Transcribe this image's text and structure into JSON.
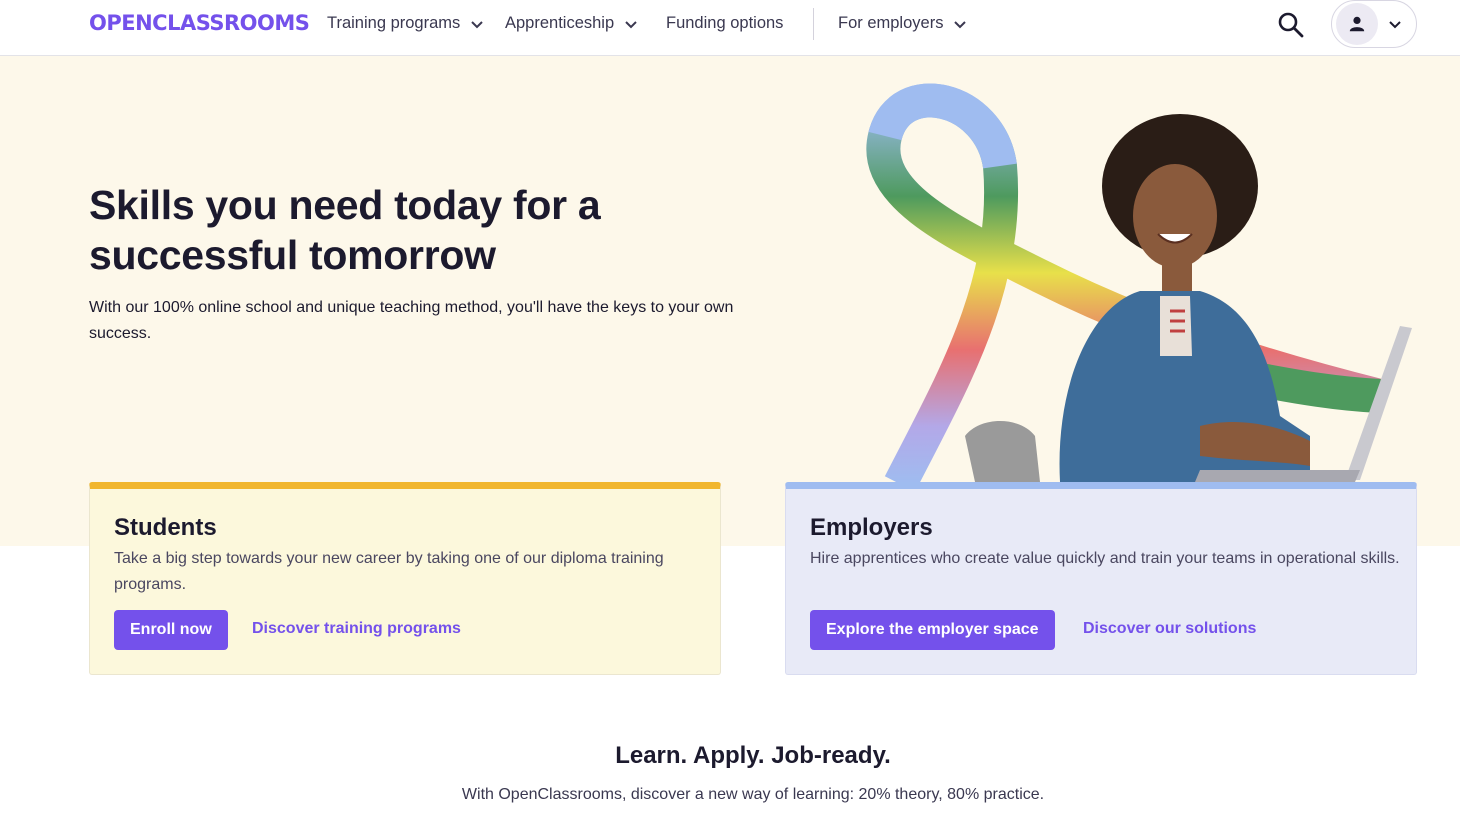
{
  "nav": {
    "logo": "OPENCLASSROOMS",
    "items": [
      {
        "label": "Training programs"
      },
      {
        "label": "Apprenticeship"
      },
      {
        "label": "Funding options"
      },
      {
        "label": "For employers"
      }
    ]
  },
  "hero": {
    "title": "Skills you need today for a successful tomorrow",
    "subtitle": "With our 100% online school and unique teaching method, you'll have the keys to your own success."
  },
  "cards": {
    "students": {
      "title": "Students",
      "text": "Take a big step towards your new career by taking one of our diploma training programs.",
      "primary": "Enroll now",
      "link": "Discover training programs"
    },
    "employers": {
      "title": "Employers",
      "text": "Hire apprentices who create value quickly and train your teams in operational skills.",
      "primary": "Explore the employer space",
      "link": "Discover our solutions"
    }
  },
  "section": {
    "title": "Learn. Apply. Job-ready.",
    "subtitle": "With OpenClassrooms, discover a new way of learning: 20% theory, 80% practice."
  },
  "colors": {
    "brand": "#7451eb",
    "hero_bg": "#fdf8ea",
    "students_accent": "#f1b62e",
    "employers_accent": "#9fbcf0"
  }
}
